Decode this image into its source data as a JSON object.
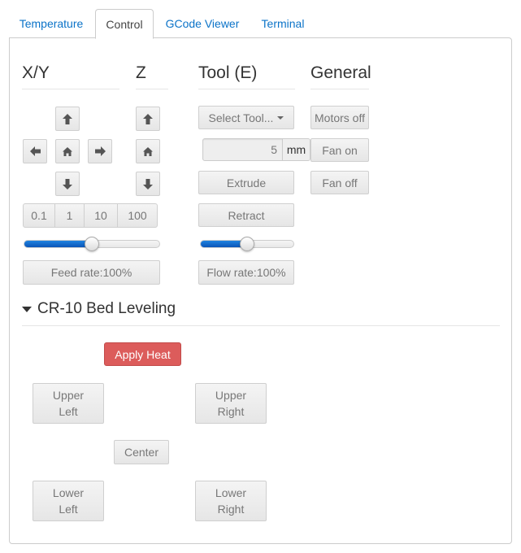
{
  "tabs": [
    {
      "label": "Temperature",
      "active": false
    },
    {
      "label": "Control",
      "active": true
    },
    {
      "label": "GCode Viewer",
      "active": false
    },
    {
      "label": "Terminal",
      "active": false
    }
  ],
  "control": {
    "xy": {
      "heading": "X/Y",
      "icons": {
        "up": "arrow-up-icon",
        "down": "arrow-down-icon",
        "left": "arrow-left-icon",
        "right": "arrow-right-icon",
        "home": "home-icon"
      },
      "step_sizes": [
        "0.1",
        "1",
        "10",
        "100"
      ],
      "feed_rate_percent": 100,
      "feed_rate_label": "Feed rate:100%"
    },
    "z": {
      "heading": "Z"
    },
    "tool": {
      "heading": "Tool (E)",
      "select_label": "Select Tool...",
      "amount_value": "5",
      "amount_unit": "mm",
      "extrude_label": "Extrude",
      "retract_label": "Retract",
      "flow_rate_percent": 100,
      "flow_rate_label": "Flow rate:100%"
    },
    "general": {
      "heading": "General",
      "motors_off_label": "Motors off",
      "fan_on_label": "Fan on",
      "fan_off_label": "Fan off"
    }
  },
  "bed_leveling": {
    "title": "CR-10 Bed Leveling",
    "apply_heat_label": "Apply Heat",
    "upper_left": {
      "line1": "Upper",
      "line2": "Left"
    },
    "upper_right": {
      "line1": "Upper",
      "line2": "Right"
    },
    "center_label": "Center",
    "lower_left": {
      "line1": "Lower",
      "line2": "Left"
    },
    "lower_right": {
      "line1": "Lower",
      "line2": "Right"
    }
  },
  "colors": {
    "accent": "#0b73c8",
    "danger": "#dc5c5b",
    "slider_fill": "#1f83e0"
  }
}
